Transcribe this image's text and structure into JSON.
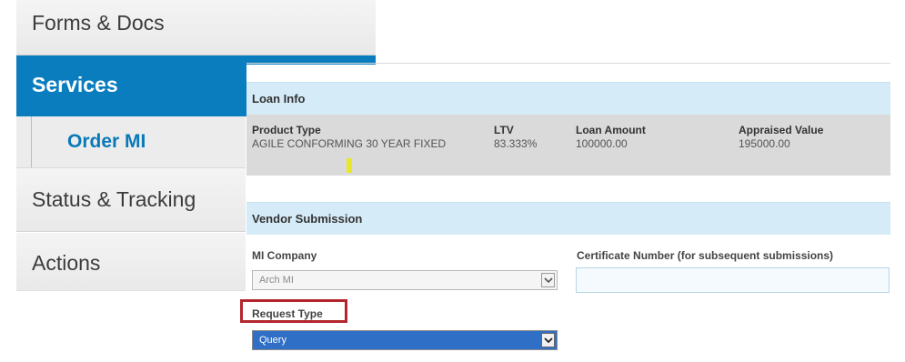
{
  "nav": {
    "forms_docs": "Forms & Docs",
    "services": "Services",
    "order_mi": "Order MI",
    "status_tracking": "Status & Tracking",
    "actions": "Actions"
  },
  "loan_info": {
    "header": "Loan Info",
    "columns": [
      {
        "label": "Product Type",
        "value": "AGILE CONFORMING 30 YEAR FIXED"
      },
      {
        "label": "LTV",
        "value": "83.333%"
      },
      {
        "label": "Loan Amount",
        "value": "100000.00"
      },
      {
        "label": "Appraised Value",
        "value": "195000.00"
      }
    ]
  },
  "vendor": {
    "header": "Vendor Submission",
    "mi_company_label": "MI Company",
    "mi_company_value": "Arch MI",
    "certificate_label": "Certificate Number (for subsequent submissions)",
    "certificate_value": "",
    "request_type_label": "Request Type",
    "request_type_value": "Query"
  },
  "colors": {
    "accent_blue": "#0a7dbf",
    "section_header_bg": "#d5ebf8",
    "highlight_outline": "#b3262c",
    "selected_option_bg": "#2f6fc6"
  }
}
